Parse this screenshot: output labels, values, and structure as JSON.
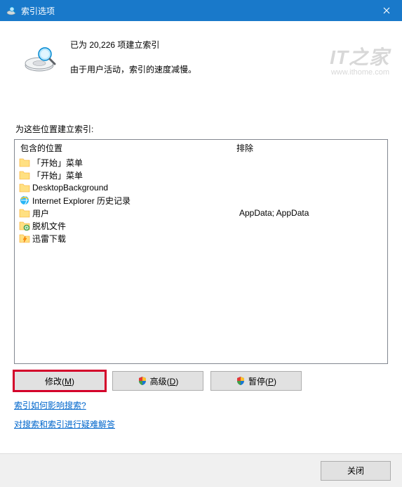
{
  "titlebar": {
    "title": "索引选项"
  },
  "status": {
    "line1": "已为 20,226 项建立索引",
    "line2": "由于用户活动，索引的速度减慢。"
  },
  "watermark": {
    "top": "IT之家",
    "url": "www.ithome.com"
  },
  "section_label": "为这些位置建立索引:",
  "columns": {
    "included": "包含的位置",
    "excluded": "排除"
  },
  "rows": [
    {
      "label": "「开始」菜单",
      "icon": "folder",
      "exclude": ""
    },
    {
      "label": "「开始」菜单",
      "icon": "folder",
      "exclude": ""
    },
    {
      "label": "DesktopBackground",
      "icon": "folder",
      "exclude": ""
    },
    {
      "label": "Internet Explorer 历史记录",
      "icon": "ie",
      "exclude": ""
    },
    {
      "label": "用户",
      "icon": "folder",
      "exclude": "AppData; AppData"
    },
    {
      "label": "脱机文件",
      "icon": "offline",
      "exclude": ""
    },
    {
      "label": "迅雷下载",
      "icon": "thunder",
      "exclude": ""
    }
  ],
  "buttons": {
    "modify": "修改(M)",
    "advanced": "高级(D)",
    "pause": "暂停(P)"
  },
  "links": {
    "how": "索引如何影响搜索?",
    "troubleshoot": "对搜索和索引进行疑难解答"
  },
  "footer": {
    "close": "关闭"
  }
}
